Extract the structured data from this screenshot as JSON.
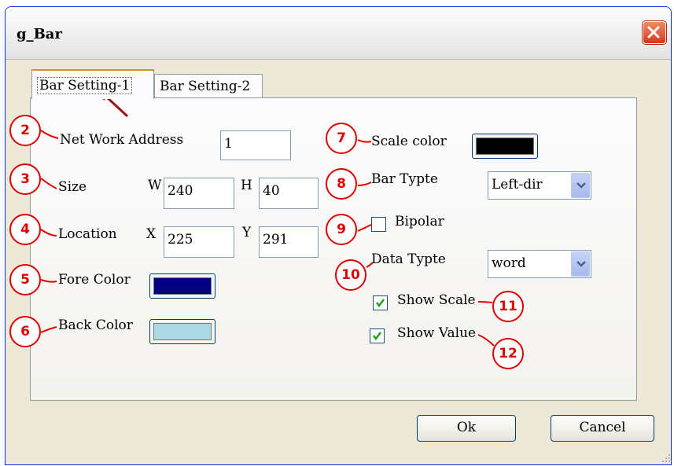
{
  "window": {
    "title": "g_Bar"
  },
  "tabs": [
    {
      "label": "Bar Setting-1",
      "active": true
    },
    {
      "label": "Bar Setting-2",
      "active": false
    }
  ],
  "left": {
    "network_address": {
      "label": "Net Work Address",
      "value": "1"
    },
    "size": {
      "label": "Size",
      "w_label": "W",
      "w_value": "240",
      "h_label": "H",
      "h_value": "40"
    },
    "location": {
      "label": "Location",
      "x_label": "X",
      "x_value": "225",
      "y_label": "Y",
      "y_value": "291"
    },
    "fore_color": {
      "label": "Fore Color",
      "color": "#000080"
    },
    "back_color": {
      "label": "Back Color",
      "color": "#add8e6"
    }
  },
  "right": {
    "scale_color": {
      "label": "Scale color",
      "color": "#000000"
    },
    "bar_type": {
      "label": "Bar Typte",
      "value": "Left-dir"
    },
    "bipolar": {
      "label": "Bipolar",
      "checked": false
    },
    "data_type": {
      "label": "Data Typte",
      "value": "word"
    },
    "show_scale": {
      "label": "Show Scale",
      "checked": true
    },
    "show_value": {
      "label": "Show Value",
      "checked": true
    }
  },
  "buttons": {
    "ok": "Ok",
    "cancel": "Cancel"
  },
  "annotations": [
    "2",
    "3",
    "4",
    "5",
    "6",
    "7",
    "8",
    "9",
    "10",
    "11",
    "12"
  ],
  "colors": {
    "annotation": "#e00000",
    "arrow": "#a01010",
    "window_border": "#0831d9",
    "face": "#ece9d8"
  }
}
